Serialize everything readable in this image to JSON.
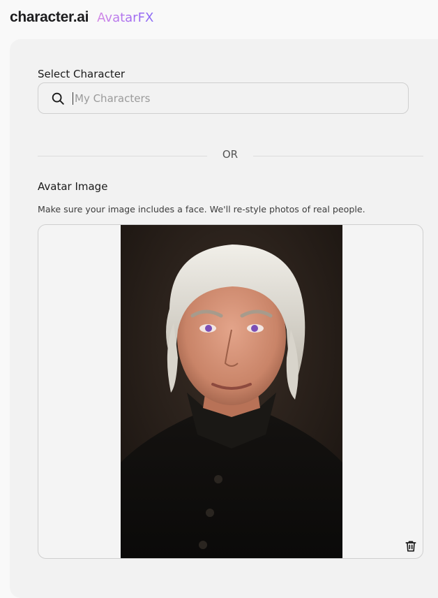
{
  "header": {
    "brand": "character.ai",
    "product": "AvatarFX"
  },
  "form": {
    "select_character_label": "Select Character",
    "search": {
      "placeholder": "My Characters",
      "value": ""
    },
    "or_label": "OR",
    "avatar_image_label": "Avatar Image",
    "avatar_hint": "Make sure your image includes a face. We'll re-style photos of real people.",
    "uploaded_image": {
      "alt": "Uploaded avatar image"
    }
  },
  "icons": {
    "search": "search-icon",
    "delete": "trash-icon"
  },
  "colors": {
    "accent_start": "#d58be6",
    "accent_end": "#8b6cf5",
    "panel": "#f2f2f2",
    "border": "#cfcfcf"
  }
}
